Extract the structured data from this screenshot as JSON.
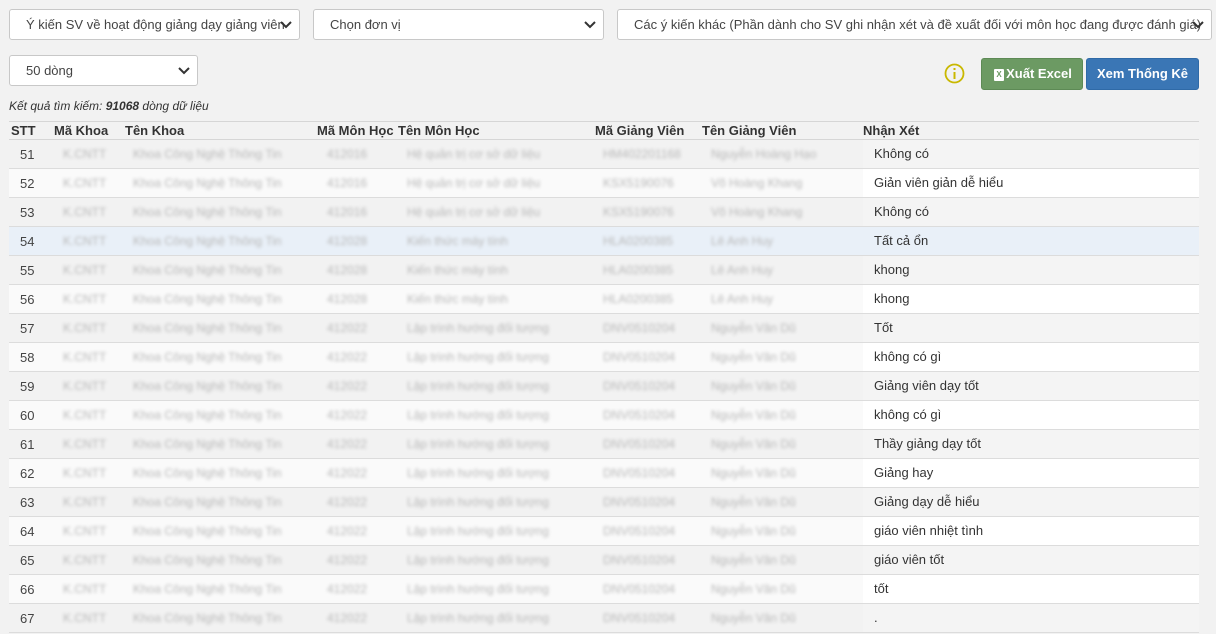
{
  "filters": {
    "survey": "Ý kiến SV về hoạt động giảng dạy giảng viên",
    "unit": "Chọn đơn vị",
    "item": "Các ý kiến khác (Phần dành cho SV ghi nhận xét và đề xuất đối với môn học đang được đánh giá)",
    "rows": "50 dòng"
  },
  "buttons": {
    "excel": "Xuất Excel",
    "stats": "Xem Thống Kê"
  },
  "result": {
    "prefix": "Kết quả tìm kiếm: ",
    "count": "91068",
    "suffix": " dòng dữ liệu"
  },
  "table": {
    "headers": [
      "STT",
      "Mã Khoa",
      "Tên Khoa",
      "Mã Môn Học",
      "Tên Môn Học",
      "Mã Giảng Viên",
      "Tên Giảng Viên",
      "Nhận Xét"
    ],
    "rows": [
      {
        "stt": "51",
        "ma_khoa": "K.CNTT",
        "ten_khoa": "Khoa Công Nghệ Thông Tin",
        "ma_mh": "412016",
        "ten_mh": "Hệ quản trị cơ sở dữ liệu",
        "ma_gv": "HM402201168",
        "ten_gv": "Nguyễn Hoàng Hạo",
        "nhan_xet": "Không có"
      },
      {
        "stt": "52",
        "ma_khoa": "K.CNTT",
        "ten_khoa": "Khoa Công Nghệ Thông Tin",
        "ma_mh": "412016",
        "ten_mh": "Hệ quản trị cơ sở dữ liệu",
        "ma_gv": "KSX5190076",
        "ten_gv": "Võ Hoàng Khang",
        "nhan_xet": "Giản viên giản dễ hiểu"
      },
      {
        "stt": "53",
        "ma_khoa": "K.CNTT",
        "ten_khoa": "Khoa Công Nghệ Thông Tin",
        "ma_mh": "412016",
        "ten_mh": "Hệ quản trị cơ sở dữ liệu",
        "ma_gv": "KSX5190076",
        "ten_gv": "Võ Hoàng Khang",
        "nhan_xet": "Không có"
      },
      {
        "stt": "54",
        "ma_khoa": "K.CNTT",
        "ten_khoa": "Khoa Công Nghệ Thông Tin",
        "ma_mh": "412028",
        "ten_mh": "Kiến thức máy tính",
        "ma_gv": "HLA0200385",
        "ten_gv": "Lê Anh Huy",
        "nhan_xet": "Tất cả ổn"
      },
      {
        "stt": "55",
        "ma_khoa": "K.CNTT",
        "ten_khoa": "Khoa Công Nghệ Thông Tin",
        "ma_mh": "412028",
        "ten_mh": "Kiến thức máy tính",
        "ma_gv": "HLA0200385",
        "ten_gv": "Lê Anh Huy",
        "nhan_xet": "khong"
      },
      {
        "stt": "56",
        "ma_khoa": "K.CNTT",
        "ten_khoa": "Khoa Công Nghệ Thông Tin",
        "ma_mh": "412028",
        "ten_mh": "Kiến thức máy tính",
        "ma_gv": "HLA0200385",
        "ten_gv": "Lê Anh Huy",
        "nhan_xet": "khong"
      },
      {
        "stt": "57",
        "ma_khoa": "K.CNTT",
        "ten_khoa": "Khoa Công Nghệ Thông Tin",
        "ma_mh": "412022",
        "ten_mh": "Lập trình hướng đối tượng",
        "ma_gv": "DNV0510204",
        "ten_gv": "Nguyễn Văn Dũ",
        "nhan_xet": "Tốt"
      },
      {
        "stt": "58",
        "ma_khoa": "K.CNTT",
        "ten_khoa": "Khoa Công Nghệ Thông Tin",
        "ma_mh": "412022",
        "ten_mh": "Lập trình hướng đối tượng",
        "ma_gv": "DNV0510204",
        "ten_gv": "Nguyễn Văn Dũ",
        "nhan_xet": "không có gì"
      },
      {
        "stt": "59",
        "ma_khoa": "K.CNTT",
        "ten_khoa": "Khoa Công Nghệ Thông Tin",
        "ma_mh": "412022",
        "ten_mh": "Lập trình hướng đối tượng",
        "ma_gv": "DNV0510204",
        "ten_gv": "Nguyễn Văn Dũ",
        "nhan_xet": "Giảng viên dạy tốt"
      },
      {
        "stt": "60",
        "ma_khoa": "K.CNTT",
        "ten_khoa": "Khoa Công Nghệ Thông Tin",
        "ma_mh": "412022",
        "ten_mh": "Lập trình hướng đối tượng",
        "ma_gv": "DNV0510204",
        "ten_gv": "Nguyễn Văn Dũ",
        "nhan_xet": "không có gì"
      },
      {
        "stt": "61",
        "ma_khoa": "K.CNTT",
        "ten_khoa": "Khoa Công Nghệ Thông Tin",
        "ma_mh": "412022",
        "ten_mh": "Lập trình hướng đối tượng",
        "ma_gv": "DNV0510204",
        "ten_gv": "Nguyễn Văn Dũ",
        "nhan_xet": "Thầy giảng dạy tốt"
      },
      {
        "stt": "62",
        "ma_khoa": "K.CNTT",
        "ten_khoa": "Khoa Công Nghệ Thông Tin",
        "ma_mh": "412022",
        "ten_mh": "Lập trình hướng đối tượng",
        "ma_gv": "DNV0510204",
        "ten_gv": "Nguyễn Văn Dũ",
        "nhan_xet": "Giảng hay"
      },
      {
        "stt": "63",
        "ma_khoa": "K.CNTT",
        "ten_khoa": "Khoa Công Nghệ Thông Tin",
        "ma_mh": "412022",
        "ten_mh": "Lập trình hướng đối tượng",
        "ma_gv": "DNV0510204",
        "ten_gv": "Nguyễn Văn Dũ",
        "nhan_xet": "Giảng dạy dễ hiểu"
      },
      {
        "stt": "64",
        "ma_khoa": "K.CNTT",
        "ten_khoa": "Khoa Công Nghệ Thông Tin",
        "ma_mh": "412022",
        "ten_mh": "Lập trình hướng đối tượng",
        "ma_gv": "DNV0510204",
        "ten_gv": "Nguyễn Văn Dũ",
        "nhan_xet": "giáo viên nhiệt tình"
      },
      {
        "stt": "65",
        "ma_khoa": "K.CNTT",
        "ten_khoa": "Khoa Công Nghệ Thông Tin",
        "ma_mh": "412022",
        "ten_mh": "Lập trình hướng đối tượng",
        "ma_gv": "DNV0510204",
        "ten_gv": "Nguyễn Văn Dũ",
        "nhan_xet": "giáo viên tốt"
      },
      {
        "stt": "66",
        "ma_khoa": "K.CNTT",
        "ten_khoa": "Khoa Công Nghệ Thông Tin",
        "ma_mh": "412022",
        "ten_mh": "Lập trình hướng đối tượng",
        "ma_gv": "DNV0510204",
        "ten_gv": "Nguyễn Văn Dũ",
        "nhan_xet": "tốt"
      },
      {
        "stt": "67",
        "ma_khoa": "K.CNTT",
        "ten_khoa": "Khoa Công Nghệ Thông Tin",
        "ma_mh": "412022",
        "ten_mh": "Lập trình hướng đối tượng",
        "ma_gv": "DNV0510204",
        "ten_gv": "Nguyễn Văn Dũ",
        "nhan_xet": "."
      }
    ]
  },
  "colors": {
    "excel": "#6c9a63",
    "stats": "#3a76b5",
    "info": "#c9b800",
    "highlight_row": "#e9f0f8"
  },
  "icons": {
    "info": "info-circle-icon",
    "excel": "excel-file-icon",
    "chevron": "chevron-down-icon"
  }
}
